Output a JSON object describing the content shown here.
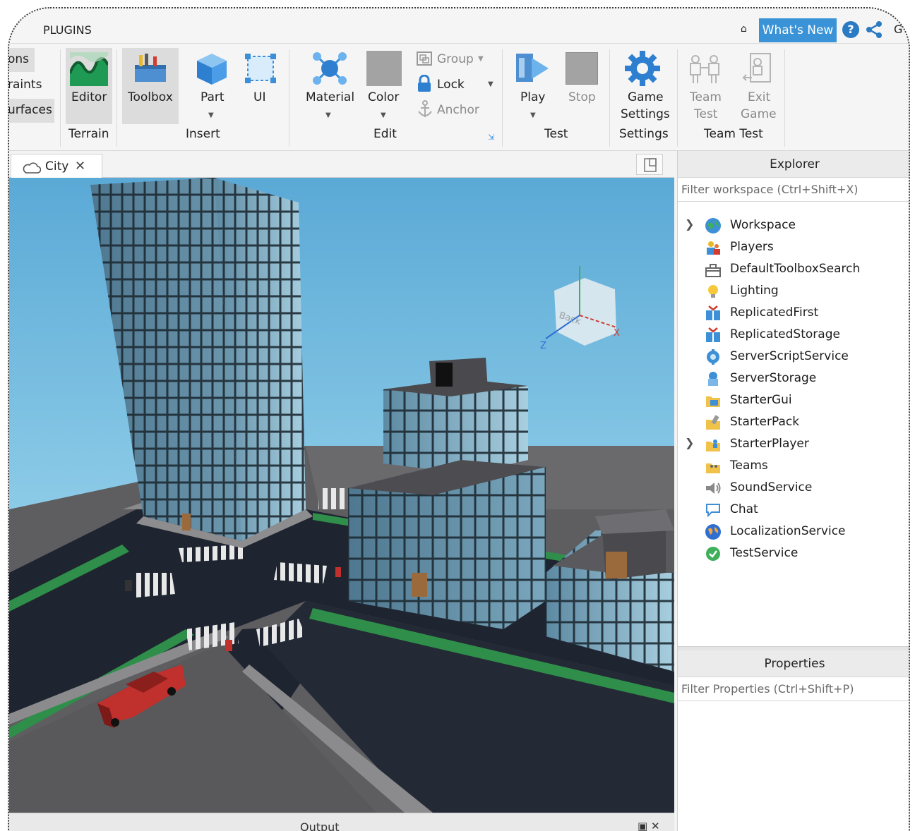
{
  "menubar": {
    "tab": "PLUGINS",
    "whats_new": "What's New",
    "help_glyph": "?",
    "cut_glyph": "G"
  },
  "ribbon": {
    "left_cut_items": [
      "ons",
      "raints",
      "urfaces"
    ],
    "terrain": {
      "editor": "Editor",
      "group": "Terrain"
    },
    "insert": {
      "toolbox": "Toolbox",
      "part": "Part",
      "ui": "UI",
      "group": "Insert"
    },
    "edit": {
      "material": "Material",
      "color": "Color",
      "group_btn": "Group",
      "lock": "Lock",
      "anchor": "Anchor",
      "group": "Edit"
    },
    "test": {
      "play": "Play",
      "stop": "Stop",
      "group": "Test"
    },
    "settings": {
      "game_settings_1": "Game",
      "game_settings_2": "Settings",
      "group": "Settings"
    },
    "team_test": {
      "team_test_1": "Team",
      "team_test_2": "Test",
      "exit_game_1": "Exit",
      "exit_game_2": "Game",
      "group": "Team Test"
    }
  },
  "document": {
    "tab_name": "City",
    "close": "✕"
  },
  "viewport": {
    "cube_face": "Back",
    "axis_x": "X",
    "axis_z": "Z"
  },
  "output": {
    "title": "Output"
  },
  "explorer": {
    "title": "Explorer",
    "filter_placeholder": "Filter workspace (Ctrl+Shift+X)",
    "items": [
      {
        "label": "Workspace",
        "icon": "globe-icon",
        "expandable": true
      },
      {
        "label": "Players",
        "icon": "players-icon",
        "expandable": false
      },
      {
        "label": "DefaultToolboxSearch",
        "icon": "toolbox-search-icon",
        "expandable": false
      },
      {
        "label": "Lighting",
        "icon": "lightbulb-icon",
        "expandable": false
      },
      {
        "label": "ReplicatedFirst",
        "icon": "replicated-first-icon",
        "expandable": false
      },
      {
        "label": "ReplicatedStorage",
        "icon": "replicated-storage-icon",
        "expandable": false
      },
      {
        "label": "ServerScriptService",
        "icon": "server-script-icon",
        "expandable": false
      },
      {
        "label": "ServerStorage",
        "icon": "server-storage-icon",
        "expandable": false
      },
      {
        "label": "StarterGui",
        "icon": "starter-gui-icon",
        "expandable": false
      },
      {
        "label": "StarterPack",
        "icon": "starter-pack-icon",
        "expandable": false
      },
      {
        "label": "StarterPlayer",
        "icon": "starter-player-icon",
        "expandable": true
      },
      {
        "label": "Teams",
        "icon": "teams-icon",
        "expandable": false
      },
      {
        "label": "SoundService",
        "icon": "speaker-icon",
        "expandable": false
      },
      {
        "label": "Chat",
        "icon": "chat-bubble-icon",
        "expandable": false
      },
      {
        "label": "LocalizationService",
        "icon": "localization-icon",
        "expandable": false
      },
      {
        "label": "TestService",
        "icon": "check-circle-icon",
        "expandable": false
      }
    ]
  },
  "properties": {
    "title": "Properties",
    "filter_placeholder": "Filter Properties (Ctrl+Shift+P)"
  },
  "colors": {
    "accent": "#3a93d6",
    "sky": "#7fc4e4",
    "road": "#1f2530",
    "grass": "#2f8f4a",
    "car": "#c0302d"
  }
}
